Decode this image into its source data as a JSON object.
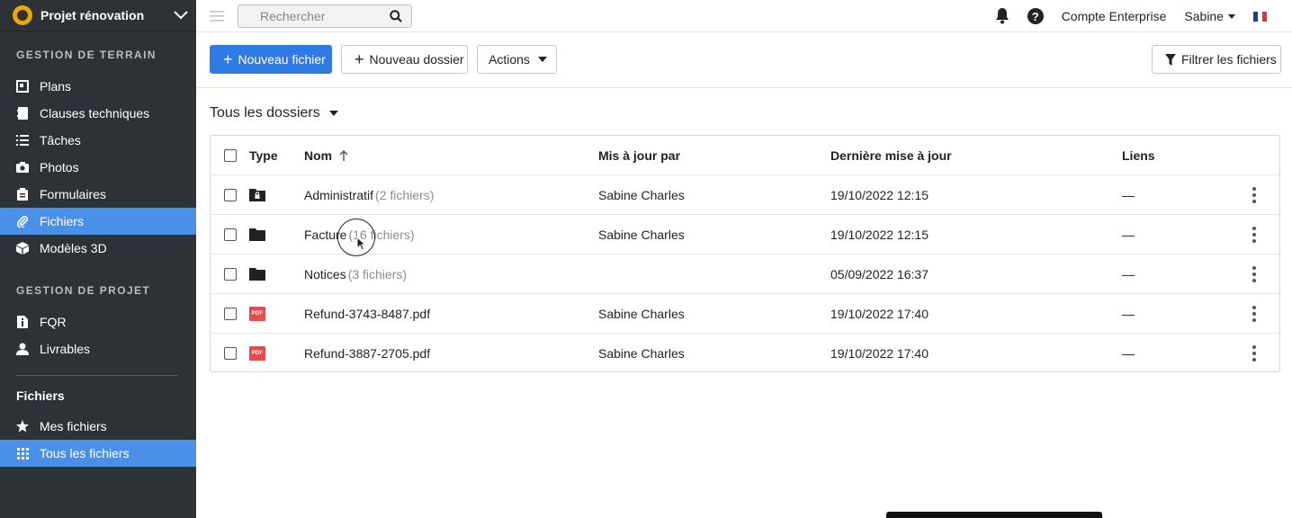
{
  "project": {
    "name": "Projet rénovation"
  },
  "sidebar": {
    "section1": "GESTION DE TERRAIN",
    "terrain_items": [
      {
        "label": "Plans",
        "icon": "plans-icon"
      },
      {
        "label": "Clauses techniques",
        "icon": "notebook-icon"
      },
      {
        "label": "Tâches",
        "icon": "list-icon"
      },
      {
        "label": "Photos",
        "icon": "camera-icon"
      },
      {
        "label": "Formulaires",
        "icon": "clipboard-icon"
      },
      {
        "label": "Fichiers",
        "icon": "paperclip-icon",
        "active": true
      },
      {
        "label": "Modèles 3D",
        "icon": "cube-icon"
      }
    ],
    "section2": "GESTION DE PROJET",
    "projet_items": [
      {
        "label": "FQR",
        "icon": "document-info-icon"
      },
      {
        "label": "Livrables",
        "icon": "user-icon"
      }
    ],
    "files_heading": "Fichiers",
    "files_items": [
      {
        "label": "Mes fichiers",
        "icon": "star-icon"
      },
      {
        "label": "Tous les fichiers",
        "icon": "grid-icon",
        "active": true
      }
    ]
  },
  "topbar": {
    "search_placeholder": "Rechercher",
    "account": "Compte Enterprise",
    "user": "Sabine",
    "help": "?"
  },
  "toolbar": {
    "new_file": "Nouveau fichier",
    "new_folder": "Nouveau dossier",
    "actions": "Actions",
    "filter": "Filtrer les fichiers"
  },
  "folder_title": "Tous les dossiers",
  "table": {
    "headers": {
      "type": "Type",
      "name": "Nom",
      "updated_by": "Mis à jour par",
      "updated_at": "Dernière mise à jour",
      "links": "Liens"
    },
    "rows": [
      {
        "type": "locked-folder",
        "name": "Administratif",
        "count": "(2 fichiers)",
        "updated_by": "Sabine Charles",
        "updated_at": "19/10/2022 12:15",
        "links": "—"
      },
      {
        "type": "folder",
        "name": "Facture",
        "count": "(16 fichiers)",
        "updated_by": "Sabine Charles",
        "updated_at": "19/10/2022 12:15",
        "links": "—"
      },
      {
        "type": "folder",
        "name": "Notices",
        "count": "(3 fichiers)",
        "updated_by": "",
        "updated_at": "05/09/2022 16:37",
        "links": "—"
      },
      {
        "type": "pdf",
        "name": "Refund-3743-8487.pdf",
        "count": "",
        "updated_by": "Sabine Charles",
        "updated_at": "19/10/2022 17:40",
        "links": "—"
      },
      {
        "type": "pdf",
        "name": "Refund-3887-2705.pdf",
        "count": "",
        "updated_by": "Sabine Charles",
        "updated_at": "19/10/2022 17:40",
        "links": "—"
      }
    ],
    "pdf_badge": "PDF"
  }
}
